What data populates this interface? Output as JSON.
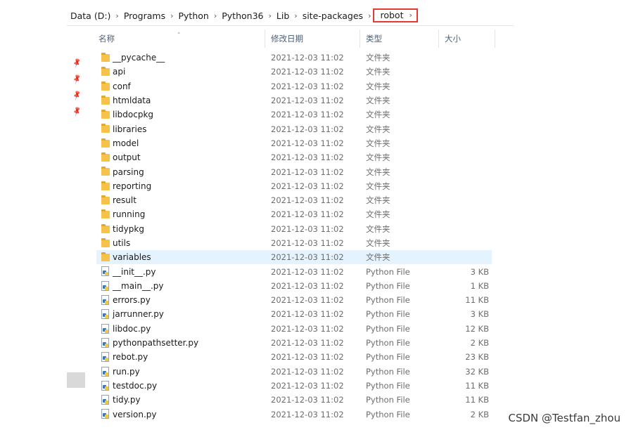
{
  "breadcrumb": {
    "items": [
      "Data (D:)",
      "Programs",
      "Python",
      "Python36",
      "Lib",
      "site-packages"
    ],
    "current": "robot"
  },
  "columns": {
    "name": "名称",
    "date": "修改日期",
    "type": "类型",
    "size": "大小"
  },
  "colors": {
    "highlight_border": "#e53935",
    "selected_row": "#e5f3ff",
    "header_text": "#4c607a"
  },
  "files": [
    {
      "name": "__pycache__",
      "date": "2021-12-03 11:02",
      "type": "文件夹",
      "size": "",
      "icon": "folder-icon"
    },
    {
      "name": "api",
      "date": "2021-12-03 11:02",
      "type": "文件夹",
      "size": "",
      "icon": "folder-icon"
    },
    {
      "name": "conf",
      "date": "2021-12-03 11:02",
      "type": "文件夹",
      "size": "",
      "icon": "folder-icon"
    },
    {
      "name": "htmldata",
      "date": "2021-12-03 11:02",
      "type": "文件夹",
      "size": "",
      "icon": "folder-icon"
    },
    {
      "name": "libdocpkg",
      "date": "2021-12-03 11:02",
      "type": "文件夹",
      "size": "",
      "icon": "folder-icon"
    },
    {
      "name": "libraries",
      "date": "2021-12-03 11:02",
      "type": "文件夹",
      "size": "",
      "icon": "folder-icon"
    },
    {
      "name": "model",
      "date": "2021-12-03 11:02",
      "type": "文件夹",
      "size": "",
      "icon": "folder-icon"
    },
    {
      "name": "output",
      "date": "2021-12-03 11:02",
      "type": "文件夹",
      "size": "",
      "icon": "folder-icon"
    },
    {
      "name": "parsing",
      "date": "2021-12-03 11:02",
      "type": "文件夹",
      "size": "",
      "icon": "folder-icon"
    },
    {
      "name": "reporting",
      "date": "2021-12-03 11:02",
      "type": "文件夹",
      "size": "",
      "icon": "folder-icon"
    },
    {
      "name": "result",
      "date": "2021-12-03 11:02",
      "type": "文件夹",
      "size": "",
      "icon": "folder-icon"
    },
    {
      "name": "running",
      "date": "2021-12-03 11:02",
      "type": "文件夹",
      "size": "",
      "icon": "folder-icon"
    },
    {
      "name": "tidypkg",
      "date": "2021-12-03 11:02",
      "type": "文件夹",
      "size": "",
      "icon": "folder-icon"
    },
    {
      "name": "utils",
      "date": "2021-12-03 11:02",
      "type": "文件夹",
      "size": "",
      "icon": "folder-icon"
    },
    {
      "name": "variables",
      "date": "2021-12-03 11:02",
      "type": "文件夹",
      "size": "",
      "icon": "folder-icon",
      "selected": true
    },
    {
      "name": "__init__.py",
      "date": "2021-12-03 11:02",
      "type": "Python File",
      "size": "3 KB",
      "icon": "python-file-icon"
    },
    {
      "name": "__main__.py",
      "date": "2021-12-03 11:02",
      "type": "Python File",
      "size": "1 KB",
      "icon": "python-file-icon"
    },
    {
      "name": "errors.py",
      "date": "2021-12-03 11:02",
      "type": "Python File",
      "size": "11 KB",
      "icon": "python-file-icon"
    },
    {
      "name": "jarrunner.py",
      "date": "2021-12-03 11:02",
      "type": "Python File",
      "size": "3 KB",
      "icon": "python-file-icon"
    },
    {
      "name": "libdoc.py",
      "date": "2021-12-03 11:02",
      "type": "Python File",
      "size": "12 KB",
      "icon": "python-file-icon"
    },
    {
      "name": "pythonpathsetter.py",
      "date": "2021-12-03 11:02",
      "type": "Python File",
      "size": "2 KB",
      "icon": "python-file-icon"
    },
    {
      "name": "rebot.py",
      "date": "2021-12-03 11:02",
      "type": "Python File",
      "size": "23 KB",
      "icon": "python-file-icon"
    },
    {
      "name": "run.py",
      "date": "2021-12-03 11:02",
      "type": "Python File",
      "size": "32 KB",
      "icon": "python-file-icon"
    },
    {
      "name": "testdoc.py",
      "date": "2021-12-03 11:02",
      "type": "Python File",
      "size": "11 KB",
      "icon": "python-file-icon"
    },
    {
      "name": "tidy.py",
      "date": "2021-12-03 11:02",
      "type": "Python File",
      "size": "11 KB",
      "icon": "python-file-icon"
    },
    {
      "name": "version.py",
      "date": "2021-12-03 11:02",
      "type": "Python File",
      "size": "2 KB",
      "icon": "python-file-icon"
    }
  ],
  "watermark": "CSDN @Testfan_zhou"
}
